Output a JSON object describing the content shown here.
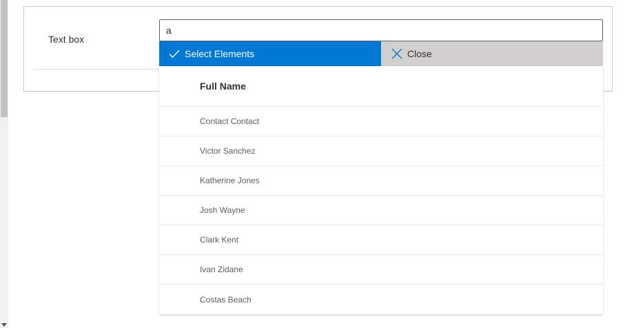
{
  "field": {
    "label": "Text box"
  },
  "search": {
    "value": "a"
  },
  "actions": {
    "select_label": "Select Elements",
    "select_icon": "checkmark-icon",
    "close_label": "Close",
    "close_icon": "close-icon"
  },
  "results": {
    "column_header": "Full Name",
    "rows": [
      {
        "full_name": "Contact Contact"
      },
      {
        "full_name": "Victor Sanchez"
      },
      {
        "full_name": "Katherine Jones"
      },
      {
        "full_name": "Josh Wayne"
      },
      {
        "full_name": "Clark Kent"
      },
      {
        "full_name": "Ivan Zidane"
      },
      {
        "full_name": "Costas Beach"
      }
    ]
  },
  "colors": {
    "accent": "#0078d4",
    "close_bg": "#d2d0ce",
    "border": "#c8c8c8"
  }
}
